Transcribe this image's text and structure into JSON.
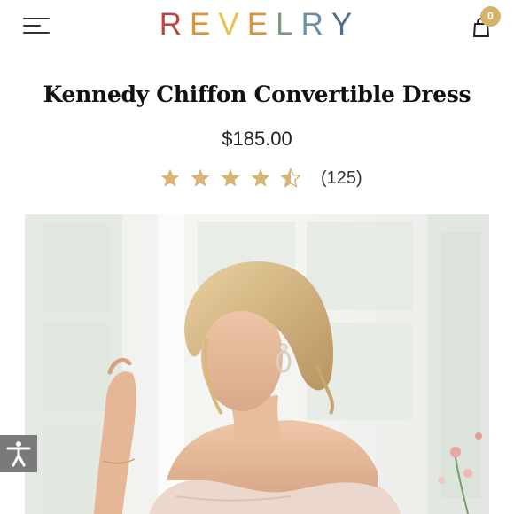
{
  "header": {
    "logo_letters": [
      {
        "char": "R",
        "color": "#b94845"
      },
      {
        "char": "E",
        "color": "#e0913b"
      },
      {
        "char": "V",
        "color": "#e8c24b"
      },
      {
        "char": "E",
        "color": "#e0913b"
      },
      {
        "char": "L",
        "color": "#7d9a7c"
      },
      {
        "char": "R",
        "color": "#6b8fa8"
      },
      {
        "char": "Y",
        "color": "#4f6f8c"
      }
    ],
    "cart_count": "0"
  },
  "product": {
    "title": "Kennedy Chiffon Convertible Dress",
    "price": "$185.00",
    "rating": 4.5,
    "review_count": "(125)"
  },
  "colors": {
    "star": "#d6b676",
    "badge": "#d5b36c",
    "accessibility_button": "#7a7a7a"
  },
  "icons": [
    "menu-icon",
    "shopping-bag-icon",
    "star-icon",
    "half-star-icon",
    "accessibility-icon"
  ]
}
